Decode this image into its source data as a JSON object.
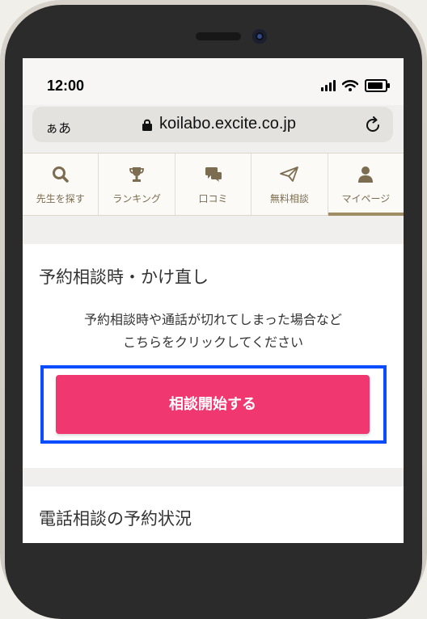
{
  "statusbar": {
    "time": "12:00"
  },
  "browser": {
    "text_size": "ぁあ",
    "url": "koilabo.excite.co.jp"
  },
  "tabs": [
    {
      "label": "先生を探す",
      "icon": "search-icon"
    },
    {
      "label": "ランキング",
      "icon": "trophy-icon"
    },
    {
      "label": "口コミ",
      "icon": "chat-icon"
    },
    {
      "label": "無料相談",
      "icon": "paper-plane-icon"
    },
    {
      "label": "マイページ",
      "icon": "user-icon",
      "active": true
    }
  ],
  "reservation": {
    "title": "予約相談時・かけ直し",
    "description_line1": "予約相談時や通話が切れてしまった場合など",
    "description_line2": "こちらをクリックしてください",
    "button_label": "相談開始する"
  },
  "phone_reservation": {
    "title": "電話相談の予約状況"
  },
  "colors": {
    "accent": "#f03770",
    "tab_text": "#7d6d50",
    "tab_active": "#a08c64",
    "highlight": "#0a4cff"
  }
}
